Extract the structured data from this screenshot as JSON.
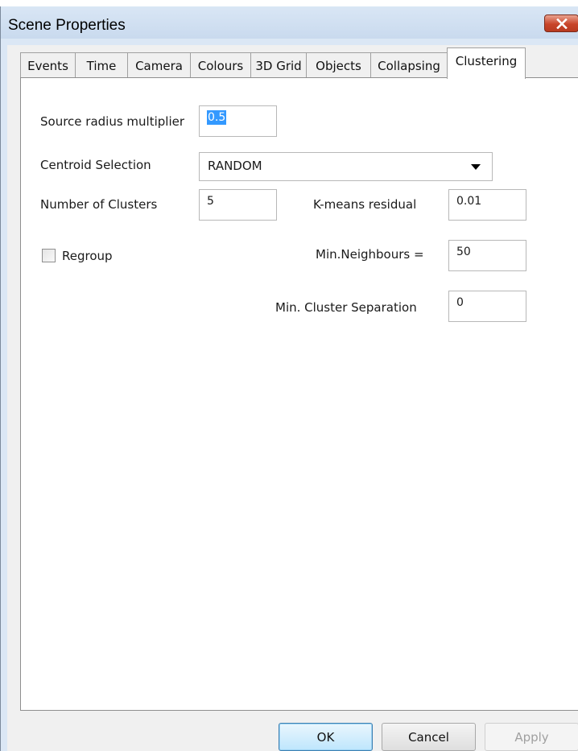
{
  "window": {
    "title": "Scene Properties",
    "close_icon": "close-icon"
  },
  "tabs": [
    {
      "label": "Events",
      "active": false
    },
    {
      "label": "Time",
      "active": false
    },
    {
      "label": "Camera",
      "active": false
    },
    {
      "label": "Colours",
      "active": false
    },
    {
      "label": "3D Grid",
      "active": false
    },
    {
      "label": "Objects",
      "active": false
    },
    {
      "label": "Collapsing",
      "active": false
    },
    {
      "label": "Clustering",
      "active": true
    }
  ],
  "clustering": {
    "source_radius_label": "Source radius multiplier",
    "source_radius_value": "0.5",
    "centroid_label": "Centroid Selection",
    "centroid_value": "RANDOM",
    "num_clusters_label": "Number of Clusters",
    "num_clusters_value": "5",
    "kmeans_label": "K-means residual",
    "kmeans_value": "0.01",
    "regroup_label": "Regroup",
    "regroup_checked": false,
    "min_neighbours_label": "Min.Neighbours =",
    "min_neighbours_value": "50",
    "min_separation_label": "Min. Cluster Separation",
    "min_separation_value": "0"
  },
  "buttons": {
    "ok": "OK",
    "cancel": "Cancel",
    "apply": "Apply"
  },
  "colors": {
    "selection": "#3399ff",
    "close_button": "#c8452a",
    "titlebar": "#d9e6f5"
  }
}
